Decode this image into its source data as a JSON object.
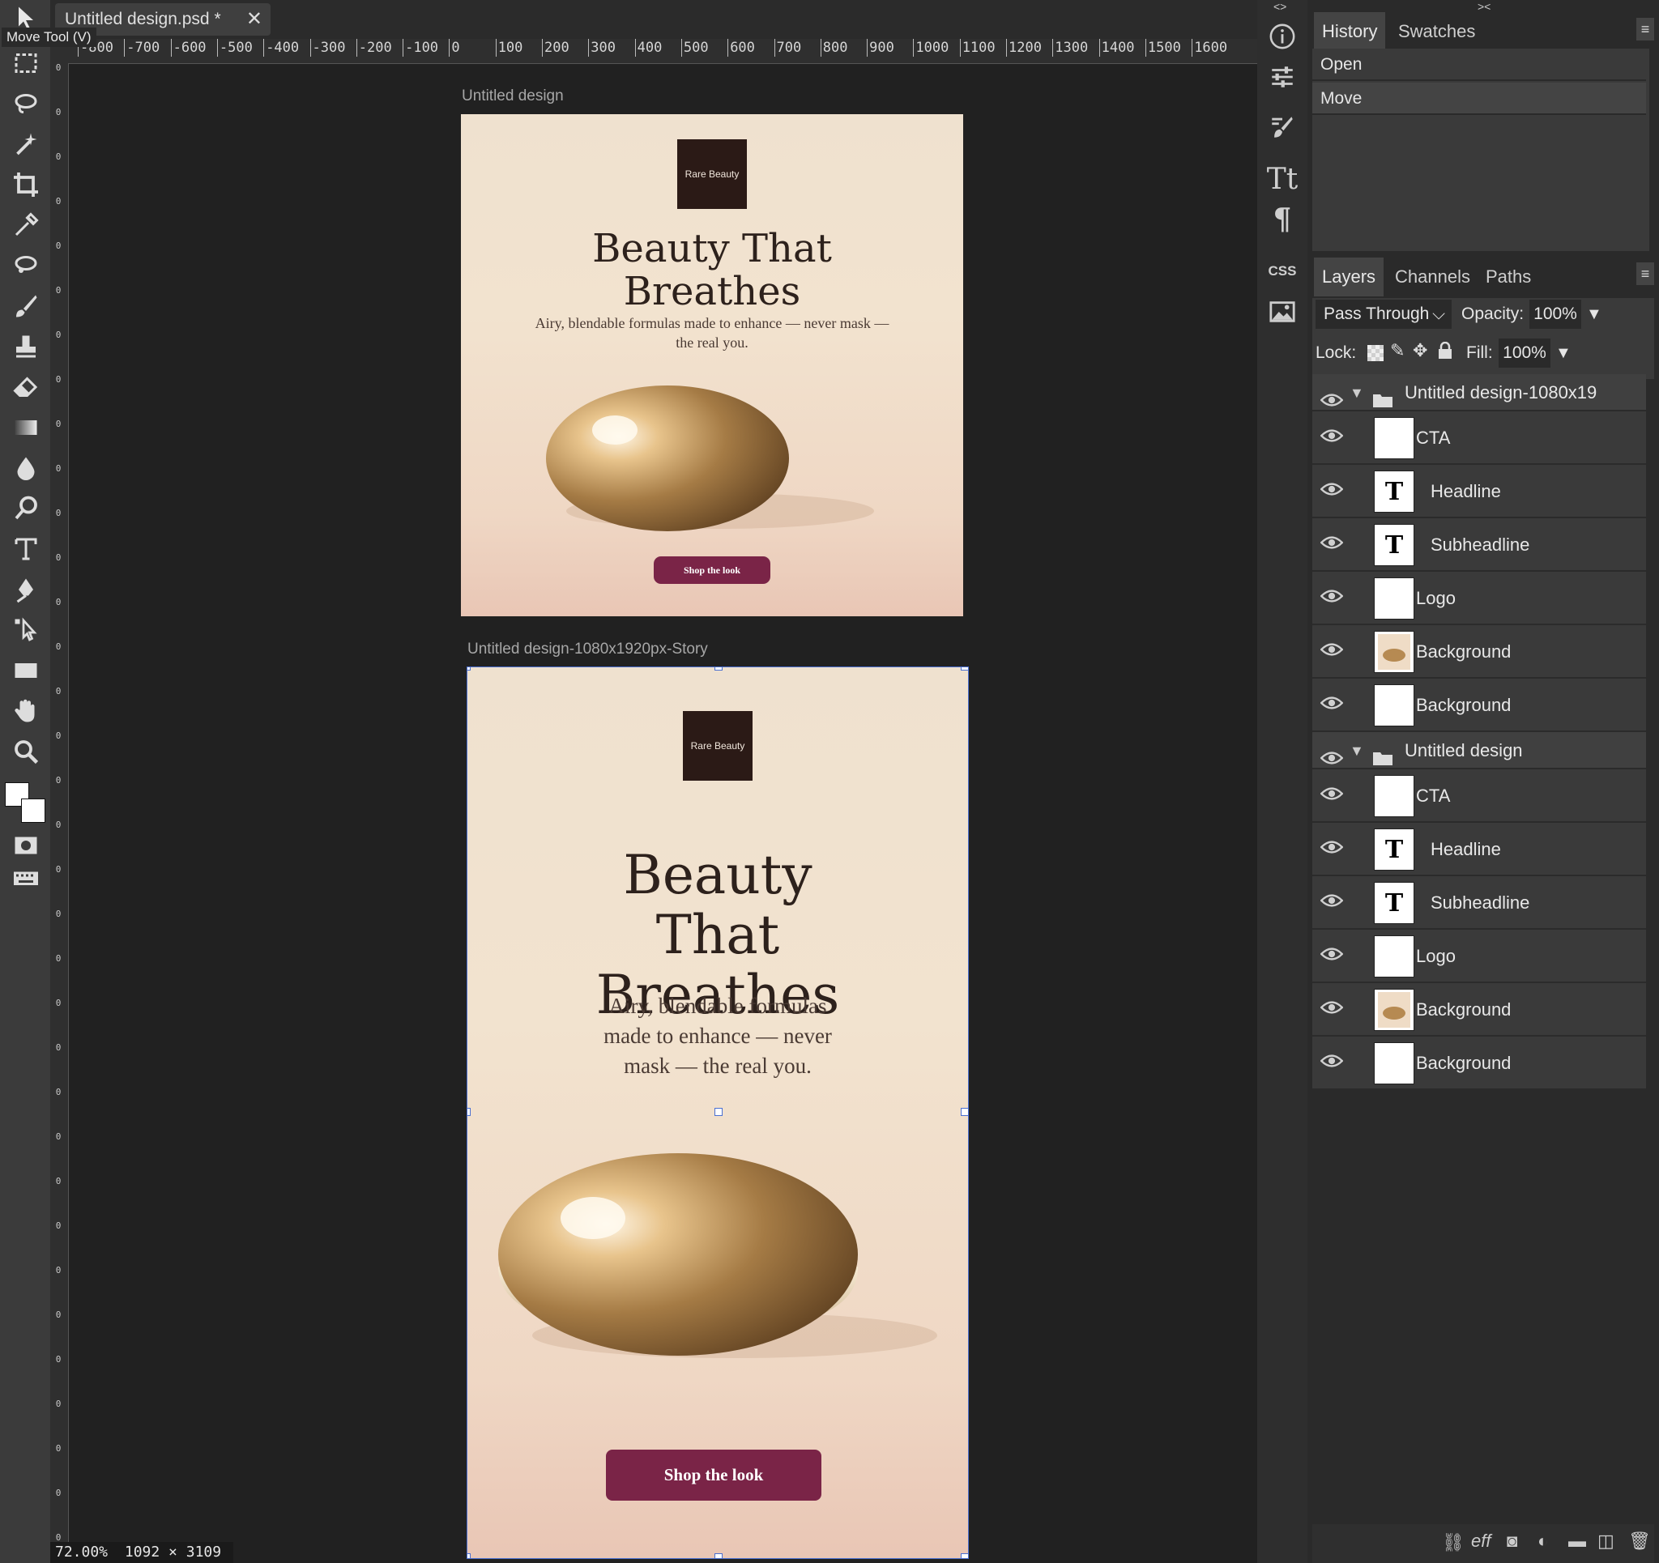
{
  "app": {
    "document_tab": "Untitled design.psd *",
    "tooltip": "Move Tool (V)",
    "status_zoom": "72.00%",
    "status_size": "1092 × 3109"
  },
  "ruler": {
    "h_labels": [
      "-800",
      "-700",
      "-600",
      "-500",
      "-400",
      "-300",
      "-200",
      "-100",
      "0",
      "100",
      "200",
      "300",
      "400",
      "500",
      "600",
      "700",
      "800",
      "900",
      "1000",
      "1100",
      "1200",
      "1300",
      "1400",
      "1500",
      "1600"
    ]
  },
  "artboards": [
    {
      "label": "Untitled design",
      "logo": "Rare Beauty",
      "headline": "Beauty That Breathes",
      "subheadline": "Airy, blendable formulas made to enhance — never mask — the real you.",
      "cta": "Shop the look"
    },
    {
      "label": "Untitled design-1080x1920px-Story",
      "logo": "Rare Beauty",
      "headline": "Beauty That Breathes",
      "subheadline": "Airy, blendable formulas made to enhance — never mask — the real you.",
      "cta": "Shop the look"
    }
  ],
  "history": {
    "tabs": [
      "History",
      "Swatches"
    ],
    "items": [
      "Open",
      "Move"
    ]
  },
  "layers_panel": {
    "tabs": [
      "Layers",
      "Channels",
      "Paths"
    ],
    "blend_mode": "Pass Through",
    "opacity_label": "Opacity:",
    "opacity": "100%",
    "lock_label": "Lock:",
    "fill_label": "Fill:",
    "fill": "100%",
    "groups": [
      {
        "name": "Untitled design-1080x19",
        "layers": [
          "CTA",
          "Headline",
          "Subheadline",
          "Logo",
          "Background",
          "Background"
        ]
      },
      {
        "name": "Untitled design",
        "layers": [
          "CTA",
          "Headline",
          "Subheadline",
          "Logo",
          "Background",
          "Background"
        ]
      }
    ]
  },
  "colors": {
    "cta": "#7a2447",
    "logo_bg": "#2b1a16",
    "accent_selection": "#4a6fd1"
  }
}
